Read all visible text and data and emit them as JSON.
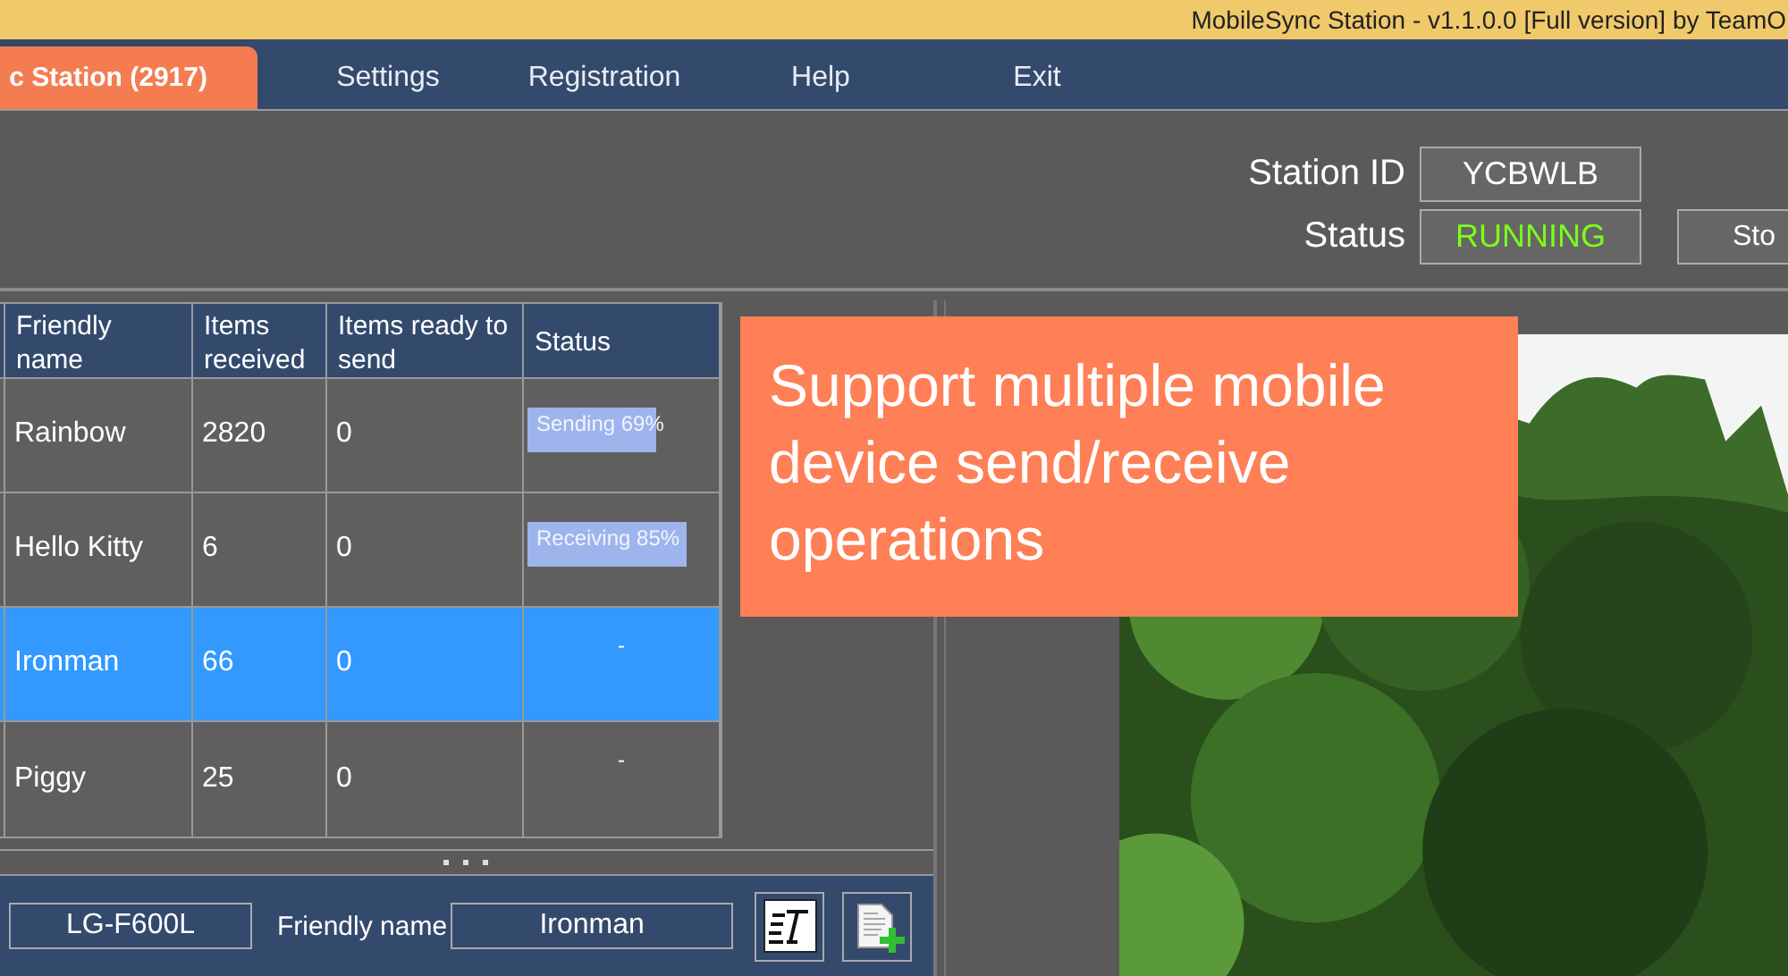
{
  "window": {
    "title": "MobileSync Station - v1.1.0.0 [Full version] by TeamO"
  },
  "tabs": [
    {
      "label": "c Station (2917)",
      "selected": true
    },
    {
      "label": "Settings",
      "selected": false
    },
    {
      "label": "Registration",
      "selected": false
    },
    {
      "label": "Help",
      "selected": false
    },
    {
      "label": "Exit",
      "selected": false
    }
  ],
  "station": {
    "id_label": "Station ID",
    "id_value": "YCBWLB",
    "status_label": "Status",
    "status_value": "RUNNING",
    "stop_button": "Sto"
  },
  "table": {
    "columns": [
      "Friendly name",
      "Items received",
      "Items ready to send",
      "Status"
    ],
    "rows": [
      {
        "name": "Rainbow",
        "received": "2820",
        "ready": "0",
        "status": {
          "kind": "progress",
          "text": "Sending 69%",
          "level": 0.69
        },
        "selected": false
      },
      {
        "name": "Hello Kitty",
        "received": "6",
        "ready": "0",
        "status": {
          "kind": "progress",
          "text": "Receiving 85%",
          "level": 0.86
        },
        "selected": false
      },
      {
        "name": "Ironman",
        "received": "66",
        "ready": "0",
        "status": {
          "kind": "idle",
          "text": "-"
        },
        "selected": true
      },
      {
        "name": "Piggy",
        "received": "25",
        "ready": "0",
        "status": {
          "kind": "idle",
          "text": "-"
        },
        "selected": false
      }
    ]
  },
  "device_bar": {
    "model": "LG-F600L",
    "friendly_label": "Friendly name",
    "friendly_value": "Ironman"
  },
  "banner": {
    "text": "Support multiple mobile device send/receive operations"
  }
}
